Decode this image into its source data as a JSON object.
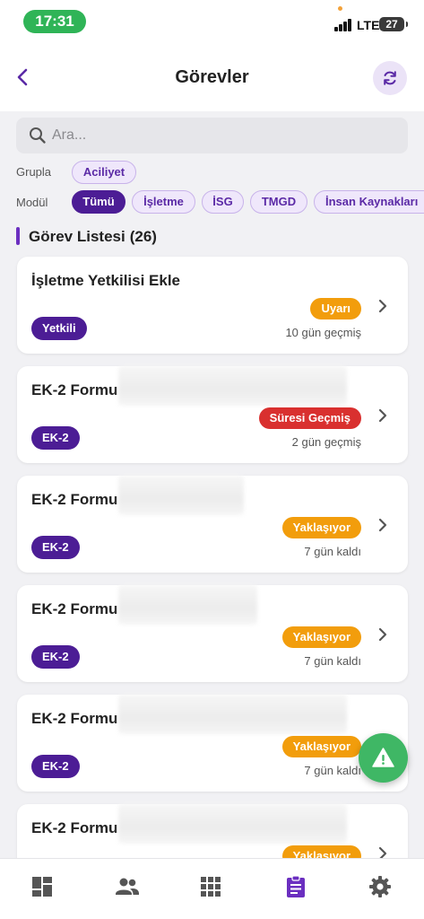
{
  "status_bar": {
    "time": "17:31",
    "network": "LTE",
    "battery": "27"
  },
  "header": {
    "title": "Görevler",
    "back_icon": "chevron-left-icon",
    "refresh_icon": "refresh-icon"
  },
  "search": {
    "placeholder": "Ara..."
  },
  "filters": {
    "group_label": "Grupla",
    "group_chips": [
      {
        "label": "Aciliyet"
      }
    ],
    "module_label": "Modül",
    "module_chips": [
      {
        "label": "Tümü",
        "active": true
      },
      {
        "label": "İşletme"
      },
      {
        "label": "İSG"
      },
      {
        "label": "TMGD"
      },
      {
        "label": "İnsan Kaynakları"
      }
    ]
  },
  "list": {
    "title": "Görev Listesi",
    "count": "(26)"
  },
  "colors": {
    "primary": "#4c1d95",
    "warning": "#f29d0c",
    "danger": "#d9302f",
    "success": "#3fb765"
  },
  "tasks": [
    {
      "title": "İşletme Yetkilisi Ekle",
      "tag": "Yetkili",
      "status": "Uyarı",
      "status_color": "#f29d0c",
      "due": "10 gün geçmiş"
    },
    {
      "title": "EK-2 Formu",
      "tag": "EK-2",
      "status": "Süresi Geçmiş",
      "status_color": "#d9302f",
      "due": "2 gün geçmiş"
    },
    {
      "title": "EK-2 Formu",
      "tag": "EK-2",
      "status": "Yaklaşıyor",
      "status_color": "#f29d0c",
      "due": "7 gün kaldı"
    },
    {
      "title": "EK-2 Formu",
      "tag": "EK-2",
      "status": "Yaklaşıyor",
      "status_color": "#f29d0c",
      "due": "7 gün kaldı"
    },
    {
      "title": "EK-2 Formu",
      "tag": "EK-2",
      "status": "Yaklaşıyor",
      "status_color": "#f29d0c",
      "due": "7 gün kaldı"
    },
    {
      "title": "EK-2 Formu",
      "tag": "",
      "status": "Yaklaşıyor",
      "status_color": "#f29d0c",
      "due": ""
    }
  ],
  "fab": {
    "icon": "warning-icon"
  },
  "bottom_nav": [
    {
      "name": "dashboard-icon"
    },
    {
      "name": "people-icon"
    },
    {
      "name": "apps-grid-icon"
    },
    {
      "name": "clipboard-icon",
      "active": true
    },
    {
      "name": "settings-gear-icon"
    }
  ]
}
